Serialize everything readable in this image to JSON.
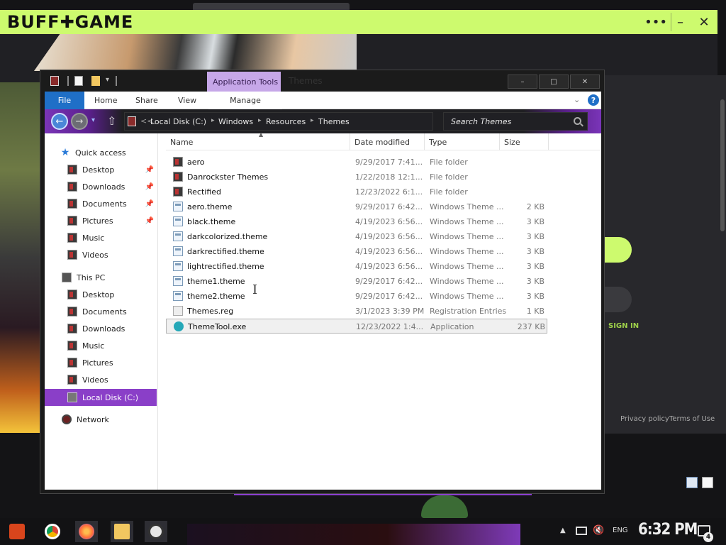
{
  "buffgame": {
    "logo": "BUFF✚GAME",
    "controls": {
      "more": "•••",
      "minimize": "–",
      "close": "✕"
    },
    "signin_label": "SIGN IN",
    "privacy_label": "Privacy policy",
    "terms_label": "Terms of Use",
    "accent_color": "#cdfa6e"
  },
  "explorer": {
    "title": "Themes",
    "context_tab": "Application Tools",
    "window_controls": {
      "minimize": "–",
      "maximize": "□",
      "close": "✕"
    },
    "ribbon": {
      "tabs": [
        "File",
        "Home",
        "Share",
        "View"
      ],
      "manage_label": "Manage",
      "help": "?",
      "file_tab_color": "#1f6fc7"
    },
    "navbar": {
      "breadcrumb": [
        "Local Disk (C:)",
        "Windows",
        "Resources",
        "Themes"
      ],
      "search_placeholder": "Search Themes",
      "overflow": "<<"
    },
    "nav_pane": {
      "quick_access": "Quick access",
      "quick_items": [
        "Desktop",
        "Downloads",
        "Documents",
        "Pictures",
        "Music",
        "Videos"
      ],
      "this_pc": "This PC",
      "pc_items": [
        "Desktop",
        "Documents",
        "Downloads",
        "Music",
        "Pictures",
        "Videos"
      ],
      "selected_drive": "Local Disk (C:)",
      "network": "Network",
      "selected_color": "#8a3fc8"
    },
    "columns": {
      "name": "Name",
      "date": "Date modified",
      "type": "Type",
      "size": "Size"
    },
    "files": [
      {
        "name": "aero",
        "date": "9/29/2017 7:41...",
        "type": "File folder",
        "size": "",
        "icon": "folder-icon"
      },
      {
        "name": "Danrockster Themes",
        "date": "1/22/2018 12:1...",
        "type": "File folder",
        "size": "",
        "icon": "folder-icon"
      },
      {
        "name": "Rectified",
        "date": "12/23/2022 6:1...",
        "type": "File folder",
        "size": "",
        "icon": "folder-icon"
      },
      {
        "name": "aero.theme",
        "date": "9/29/2017 6:42...",
        "type": "Windows Theme ...",
        "size": "2 KB",
        "icon": "theme-file-icon"
      },
      {
        "name": "black.theme",
        "date": "4/19/2023 6:56...",
        "type": "Windows Theme ...",
        "size": "3 KB",
        "icon": "theme-file-icon"
      },
      {
        "name": "darkcolorized.theme",
        "date": "4/19/2023 6:56...",
        "type": "Windows Theme ...",
        "size": "3 KB",
        "icon": "theme-file-icon"
      },
      {
        "name": "darkrectified.theme",
        "date": "4/19/2023 6:56...",
        "type": "Windows Theme ...",
        "size": "3 KB",
        "icon": "theme-file-icon"
      },
      {
        "name": "lightrectified.theme",
        "date": "4/19/2023 6:56...",
        "type": "Windows Theme ...",
        "size": "3 KB",
        "icon": "theme-file-icon"
      },
      {
        "name": "theme1.theme",
        "date": "9/29/2017 6:42...",
        "type": "Windows Theme ...",
        "size": "3 KB",
        "icon": "theme-file-icon"
      },
      {
        "name": "theme2.theme",
        "date": "9/29/2017 6:42...",
        "type": "Windows Theme ...",
        "size": "3 KB",
        "icon": "theme-file-icon"
      },
      {
        "name": "Themes.reg",
        "date": "3/1/2023 3:39 PM",
        "type": "Registration Entries",
        "size": "1 KB",
        "icon": "registry-file-icon"
      },
      {
        "name": "ThemeTool.exe",
        "date": "12/23/2022 1:4...",
        "type": "Application",
        "size": "237 KB",
        "icon": "application-icon",
        "selected": true
      }
    ]
  },
  "taskbar": {
    "apps": [
      "start-icon",
      "chrome-icon",
      "firefox-icon",
      "file-explorer-icon",
      "xbox-icon"
    ],
    "language": "ENG",
    "clock": "6:32 PM",
    "notification_count": "4"
  }
}
